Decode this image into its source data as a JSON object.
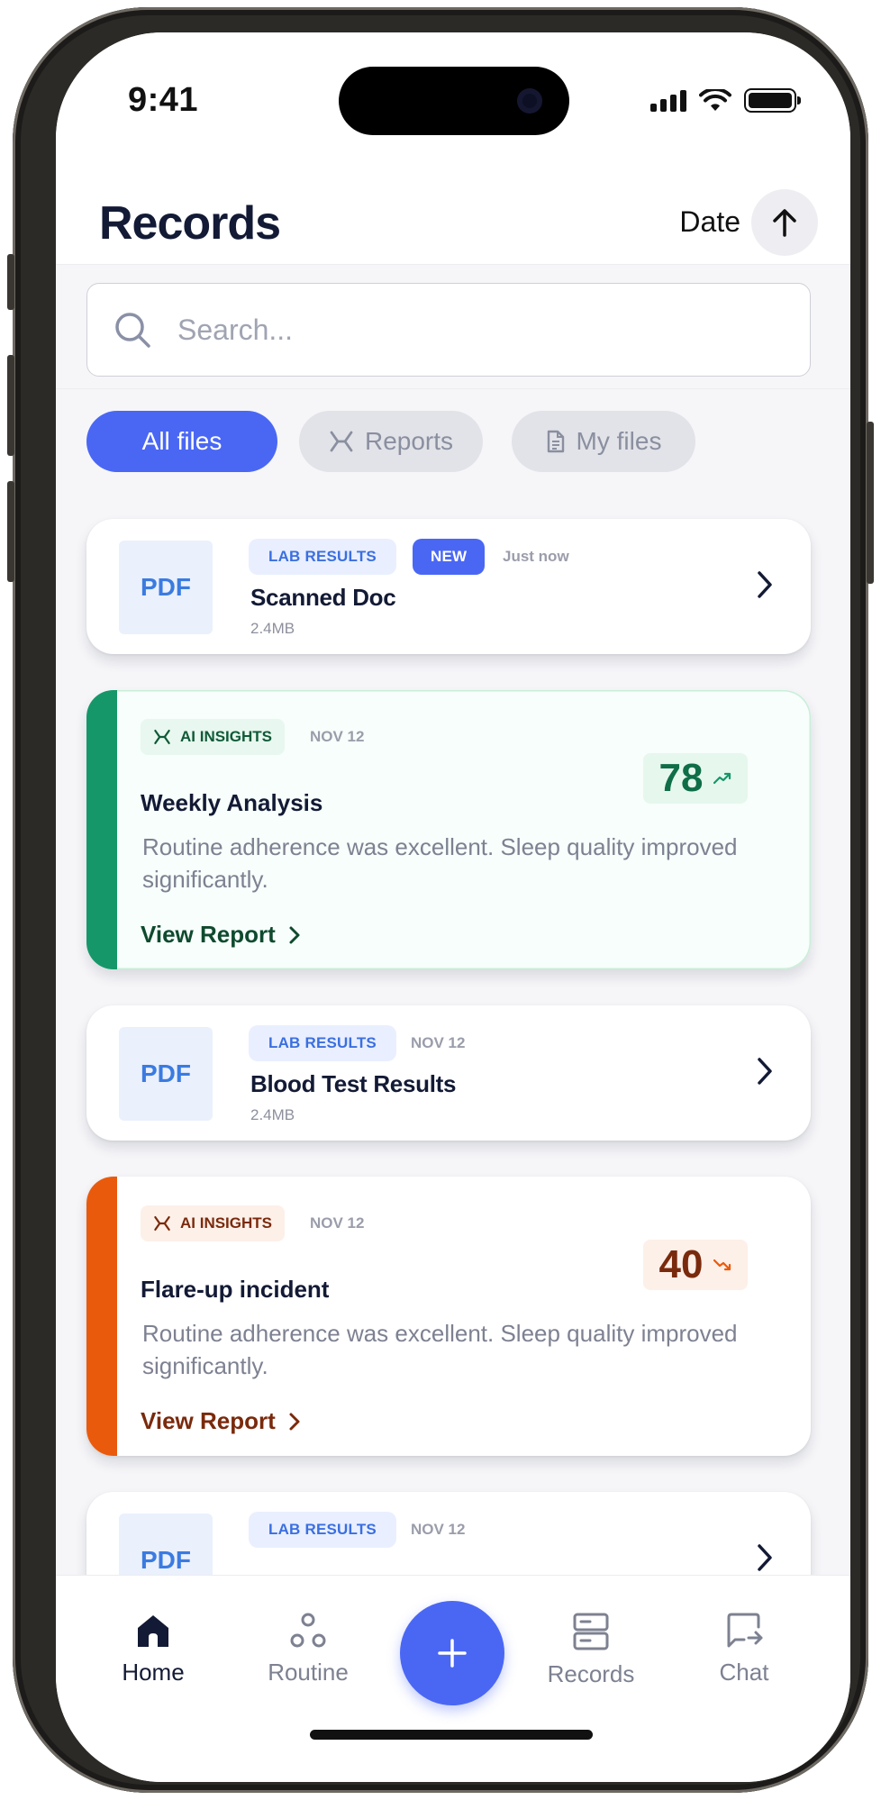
{
  "status_bar": {
    "time": "9:41"
  },
  "header": {
    "title": "Records",
    "sort_label": "Date",
    "sort_direction": "ascending",
    "sort_icon": "arrow-up-icon"
  },
  "search": {
    "placeholder": "Search...",
    "value": "",
    "icon": "search-icon"
  },
  "filters": [
    {
      "label": "All files",
      "active": true
    },
    {
      "label": "Reports",
      "active": false,
      "icon": "ai-sparkle-icon"
    },
    {
      "label": "My files",
      "active": false,
      "icon": "document-icon"
    }
  ],
  "cards": [
    {
      "kind": "file",
      "thumb": "PDF",
      "tag": "LAB RESULTS",
      "badge": "NEW",
      "date": "Just now",
      "name": "Scanned Doc",
      "size": "2.4MB"
    },
    {
      "kind": "insight",
      "tag": "AI INSIGHTS",
      "date": "NOV 12",
      "title": "Weekly Analysis",
      "body": "Routine adherence was excellent. Sleep quality improved significantly.",
      "link": "View Report",
      "score": "78",
      "trend": "up",
      "accent": "#16976a"
    },
    {
      "kind": "file",
      "thumb": "PDF",
      "tag": "LAB RESULTS",
      "date": "NOV 12",
      "name": "Blood Test Results",
      "size": "2.4MB"
    },
    {
      "kind": "insight",
      "tag": "AI INSIGHTS",
      "date": "NOV 12",
      "title": "Flare-up incident",
      "body": "Routine adherence was excellent. Sleep quality improved significantly.",
      "link": "View Report",
      "score": "40",
      "trend": "down",
      "accent": "#ea5a0c"
    },
    {
      "kind": "file",
      "thumb": "PDF",
      "tag": "LAB RESULTS",
      "date": "NOV 12"
    }
  ],
  "nav": {
    "items": [
      {
        "label": "Home",
        "icon": "home-icon",
        "active": true
      },
      {
        "label": "Routine",
        "icon": "routine-icon",
        "active": false
      },
      {
        "label": "Records",
        "icon": "records-icon",
        "active": false
      },
      {
        "label": "Chat",
        "icon": "chat-icon",
        "active": false
      }
    ],
    "fab_icon": "plus-icon"
  },
  "colors": {
    "accent": "#4a67f4",
    "positive": "#16976a",
    "negative": "#ea5a0c",
    "text_primary": "#131a35"
  }
}
